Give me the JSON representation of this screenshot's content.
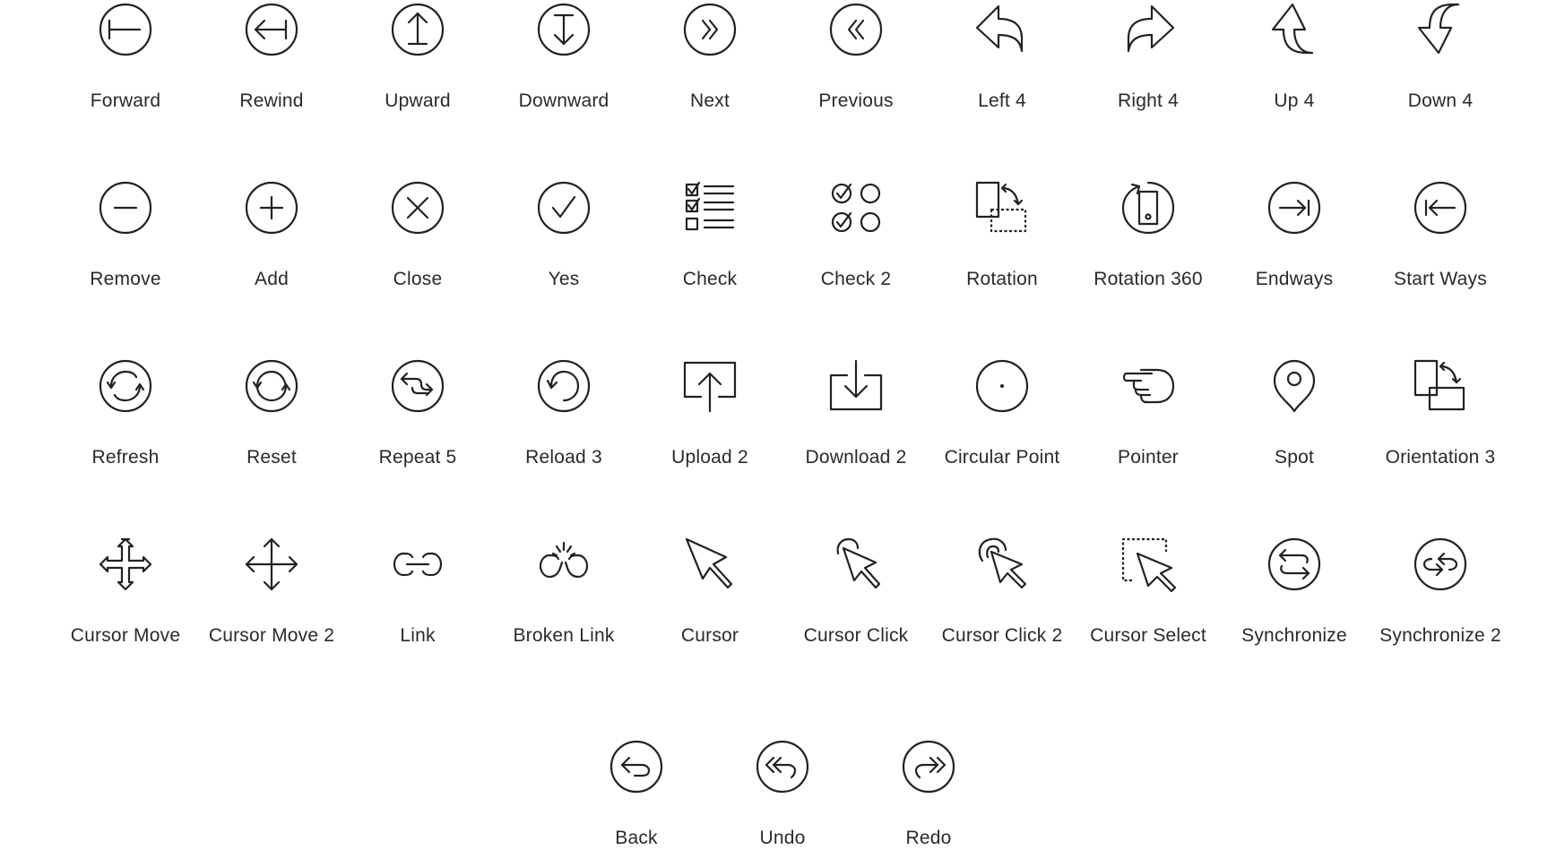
{
  "icons": [
    {
      "label": "Forward",
      "icon": "forward-icon"
    },
    {
      "label": "Rewind",
      "icon": "rewind-icon"
    },
    {
      "label": "Upward",
      "icon": "upward-icon"
    },
    {
      "label": "Downward",
      "icon": "downward-icon"
    },
    {
      "label": "Next",
      "icon": "next-icon"
    },
    {
      "label": "Previous",
      "icon": "previous-icon"
    },
    {
      "label": "Left 4",
      "icon": "left-4-icon"
    },
    {
      "label": "Right 4",
      "icon": "right-4-icon"
    },
    {
      "label": "Up 4",
      "icon": "up-4-icon"
    },
    {
      "label": "Down 4",
      "icon": "down-4-icon"
    },
    {
      "label": "Remove",
      "icon": "remove-icon"
    },
    {
      "label": "Add",
      "icon": "add-icon"
    },
    {
      "label": "Close",
      "icon": "close-icon"
    },
    {
      "label": "Yes",
      "icon": "yes-icon"
    },
    {
      "label": "Check",
      "icon": "check-icon"
    },
    {
      "label": "Check 2",
      "icon": "check-2-icon"
    },
    {
      "label": "Rotation",
      "icon": "rotation-icon"
    },
    {
      "label": "Rotation 360",
      "icon": "rotation-360-icon"
    },
    {
      "label": "Endways",
      "icon": "endways-icon"
    },
    {
      "label": "Start Ways",
      "icon": "start-ways-icon"
    },
    {
      "label": "Refresh",
      "icon": "refresh-icon"
    },
    {
      "label": "Reset",
      "icon": "reset-icon"
    },
    {
      "label": "Repeat 5",
      "icon": "repeat-5-icon"
    },
    {
      "label": "Reload 3",
      "icon": "reload-3-icon"
    },
    {
      "label": "Upload 2",
      "icon": "upload-2-icon"
    },
    {
      "label": "Download 2",
      "icon": "download-2-icon"
    },
    {
      "label": "Circular Point",
      "icon": "circular-point-icon"
    },
    {
      "label": "Pointer",
      "icon": "pointer-icon"
    },
    {
      "label": "Spot",
      "icon": "spot-icon"
    },
    {
      "label": "Orientation 3",
      "icon": "orientation-3-icon"
    },
    {
      "label": "Cursor Move",
      "icon": "cursor-move-icon"
    },
    {
      "label": "Cursor Move 2",
      "icon": "cursor-move-2-icon"
    },
    {
      "label": "Link",
      "icon": "link-icon"
    },
    {
      "label": "Broken Link",
      "icon": "broken-link-icon"
    },
    {
      "label": "Cursor",
      "icon": "cursor-icon"
    },
    {
      "label": "Cursor Click",
      "icon": "cursor-click-icon"
    },
    {
      "label": "Cursor Click 2",
      "icon": "cursor-click-2-icon"
    },
    {
      "label": "Cursor Select",
      "icon": "cursor-select-icon"
    },
    {
      "label": "Synchronize",
      "icon": "synchronize-icon"
    },
    {
      "label": "Synchronize 2",
      "icon": "synchronize-2-icon"
    },
    {
      "label": "Back",
      "icon": "back-icon"
    },
    {
      "label": "Undo",
      "icon": "undo-icon"
    },
    {
      "label": "Redo",
      "icon": "redo-icon"
    }
  ]
}
